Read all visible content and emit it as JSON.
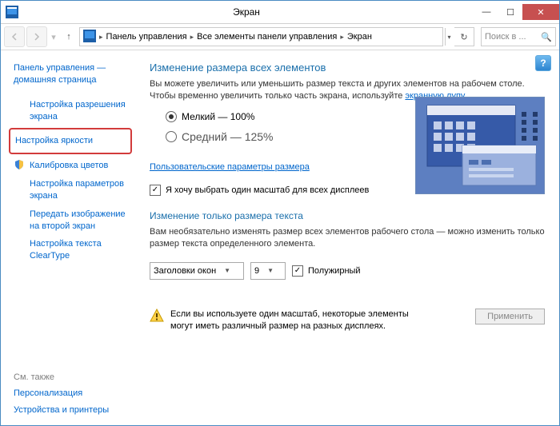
{
  "window": {
    "title": "Экран"
  },
  "breadcrumbs": {
    "b1": "Панель управления",
    "b2": "Все элементы панели управления",
    "b3": "Экран"
  },
  "search": {
    "placeholder": "Поиск в ..."
  },
  "sidebar": {
    "home": "Панель управления — домашняя страница",
    "items": [
      "Настройка разрешения экрана",
      "Настройка яркости",
      "Калибровка цветов",
      "Настройка параметров экрана",
      "Передать изображение на второй экран",
      "Настройка текста ClearType"
    ],
    "see_also_hdr": "См. также",
    "see1": "Персонализация",
    "see2": "Устройства и принтеры"
  },
  "main": {
    "h1": "Изменение размера всех элементов",
    "desc1": "Вы можете увеличить или уменьшить размер текста и других элементов на рабочем столе. Чтобы временно увеличить только часть экрана, используйте ",
    "desc1_link": "экранную лупу",
    "radio_small": "Мелкий — 100%",
    "radio_medium": "Средний — 125%",
    "custom_link": "Пользовательские параметры размера",
    "chk_all": "Я хочу выбрать один масштаб для всех дисплеев",
    "h2": "Изменение только размера текста",
    "desc2": "Вам необязательно изменять размер всех элементов рабочего стола — можно изменить только размер текста определенного элемента.",
    "select_item": "Заголовки окон",
    "select_size": "9",
    "bold": "Полужирный",
    "warning": "Если вы используете один масштаб, некоторые элементы могут иметь различный размер на разных дисплеях.",
    "apply": "Применить"
  }
}
